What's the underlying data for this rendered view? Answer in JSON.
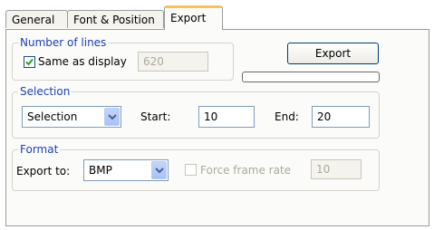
{
  "tabs": [
    {
      "label": "General"
    },
    {
      "label": "Font & Position"
    },
    {
      "label": "Export",
      "active": true
    }
  ],
  "lines_group": {
    "title": "Number of lines",
    "same_as_display": {
      "label": "Same as display",
      "checked": true
    },
    "lines_value": "620"
  },
  "export_button": {
    "label": "Export"
  },
  "export_progress": 0,
  "selection_group": {
    "title": "Selection",
    "mode": "Selection",
    "start_label": "Start:",
    "start_value": "10",
    "end_label": "End:",
    "end_value": "20"
  },
  "format_group": {
    "title": "Format",
    "export_to_label": "Export to:",
    "export_to_value": "BMP",
    "force_frame_rate": {
      "label": "Force frame rate",
      "checked": false
    },
    "frame_rate_value": "10"
  },
  "colors": {
    "group_title": "#1f3fb8",
    "active_tab_accent": "#f6c35a",
    "checkbox_border": "#1c5180",
    "checkmark": "#21a121"
  }
}
